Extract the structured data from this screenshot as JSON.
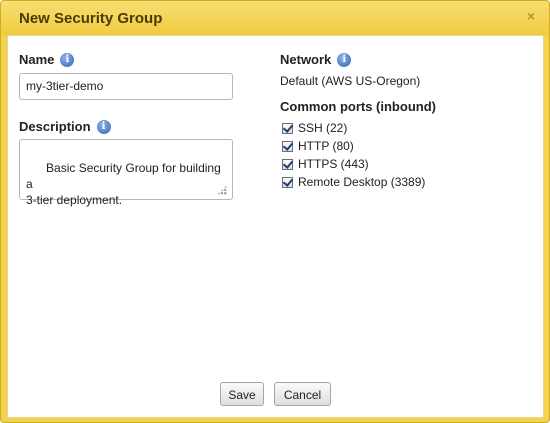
{
  "dialog": {
    "title": "New Security Group",
    "close_glyph": "×"
  },
  "form": {
    "name_label": "Name",
    "name_value": "my-3tier-demo",
    "description_label": "Description",
    "description_value": "Basic Security Group for building a\n3-tier deployment.",
    "network_label": "Network",
    "network_value": "Default (AWS US-Oregon)",
    "ports_label": "Common ports (inbound)",
    "ports": [
      {
        "label": "SSH (22)",
        "checked": true
      },
      {
        "label": "HTTP (80)",
        "checked": true
      },
      {
        "label": "HTTPS (443)",
        "checked": true
      },
      {
        "label": "Remote Desktop (3389)",
        "checked": true
      }
    ]
  },
  "buttons": {
    "save_label": "Save",
    "cancel_label": "Cancel"
  },
  "colors": {
    "titlebar": "#f3d24e",
    "info_icon": "#2f63b7",
    "checkmark": "#1f3f7a"
  },
  "icons": {
    "info": "info-icon",
    "close": "close-icon",
    "checkmark": "checkmark-icon",
    "resize": "resize-grip-icon"
  }
}
